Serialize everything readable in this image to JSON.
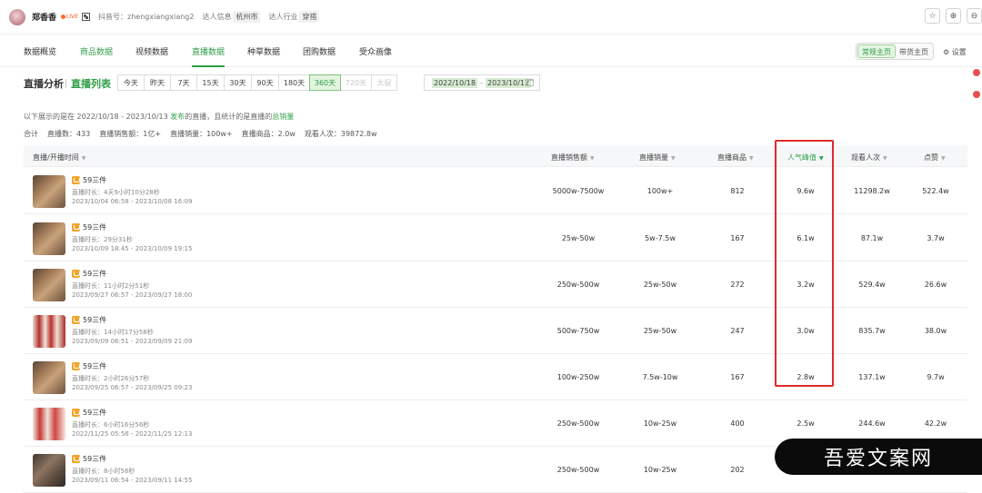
{
  "profile": {
    "name": "郑香香",
    "live_badge": "LIVE",
    "douyin_id": "抖音号：zhengxiangxiang2",
    "info_label": "达人信息",
    "city": "杭州市",
    "industry_label": "达人行业",
    "industry": "穿搭"
  },
  "nav": {
    "tabs": [
      "数据概览",
      "商品数据",
      "视频数据",
      "直播数据",
      "种草数据",
      "团购数据",
      "受众画像"
    ],
    "active": "直播数据",
    "toggle": [
      "常规主页",
      "带货主页"
    ],
    "settings": "设置"
  },
  "filter": {
    "title": "直播分析",
    "subtitle": "直播列表",
    "ranges": [
      "今天",
      "昨天",
      "7天",
      "15天",
      "30天",
      "90天",
      "180天",
      "360天",
      "720天",
      "大促"
    ],
    "active_range": "360天",
    "start_date": "2022/10/18",
    "end_date": "2023/10/12",
    "date_sep": "-"
  },
  "description": {
    "prefix": "以下展示的是在 2022/10/18 - 2023/10/13 ",
    "highlight1": "发布",
    "middle": "的直播，且统计的是直播的",
    "highlight2": "总销量"
  },
  "summary": {
    "total": "合计",
    "count": "直播数：433",
    "sales_amount": "直播销售额：1亿+",
    "sales_volume": "直播销量：100w+",
    "products": "直播商品：2.0w",
    "viewers": "观看人次：39872.8w"
  },
  "table": {
    "headers": [
      "直播/开播时间",
      "直播销售额",
      "直播销量",
      "直播商品",
      "人气峰值",
      "观看人次",
      "点赞"
    ],
    "rows": [
      {
        "goods": "59三件",
        "duration": "直播时长：4天9小时10分28秒",
        "time": "2023/10/04 06:58 - 2023/10/08 16:09",
        "amount": "5000w-7500w",
        "volume": "100w+",
        "products": "812",
        "peak": "9.6w",
        "viewers": "11298.2w",
        "likes": "522.4w",
        "thumb": "a"
      },
      {
        "goods": "59三件",
        "duration": "直播时长：29分31秒",
        "time": "2023/10/09 18:45 - 2023/10/09 19:15",
        "amount": "25w-50w",
        "volume": "5w-7.5w",
        "products": "167",
        "peak": "6.1w",
        "viewers": "87.1w",
        "likes": "3.7w",
        "thumb": "a"
      },
      {
        "goods": "59三件",
        "duration": "直播时长：11小时2分51秒",
        "time": "2023/09/27 06:57 - 2023/09/27 18:00",
        "amount": "250w-500w",
        "volume": "25w-50w",
        "products": "272",
        "peak": "3.2w",
        "viewers": "529.4w",
        "likes": "26.6w",
        "thumb": "a"
      },
      {
        "goods": "59三件",
        "duration": "直播时长：14小时17分58秒",
        "time": "2023/09/09 06:51 - 2023/09/09 21:09",
        "amount": "500w-750w",
        "volume": "25w-50w",
        "products": "247",
        "peak": "3.0w",
        "viewers": "835.7w",
        "likes": "38.0w",
        "thumb": "b"
      },
      {
        "goods": "59三件",
        "duration": "直播时长：2小时26分57秒",
        "time": "2023/09/25 06:57 - 2023/09/25 09:23",
        "amount": "100w-250w",
        "volume": "7.5w-10w",
        "products": "167",
        "peak": "2.8w",
        "viewers": "137.1w",
        "likes": "9.7w",
        "thumb": "a"
      },
      {
        "goods": "59三件",
        "duration": "直播时长：6小时16分56秒",
        "time": "2022/11/25 05:56 - 2022/11/25 12:13",
        "amount": "250w-500w",
        "volume": "10w-25w",
        "products": "400",
        "peak": "2.5w",
        "viewers": "244.6w",
        "likes": "42.2w",
        "thumb": "c"
      },
      {
        "goods": "59三件",
        "duration": "直播时长：8小时58秒",
        "time": "2023/09/11 06:54 - 2023/09/11 14:55",
        "amount": "250w-500w",
        "volume": "10w-25w",
        "products": "202",
        "peak": "",
        "viewers": "",
        "likes": "",
        "thumb": "d"
      }
    ]
  },
  "watermark": "吾爱文案网",
  "colors": {
    "accent": "#2f9d46",
    "highlight_box": "#e02a2a"
  }
}
